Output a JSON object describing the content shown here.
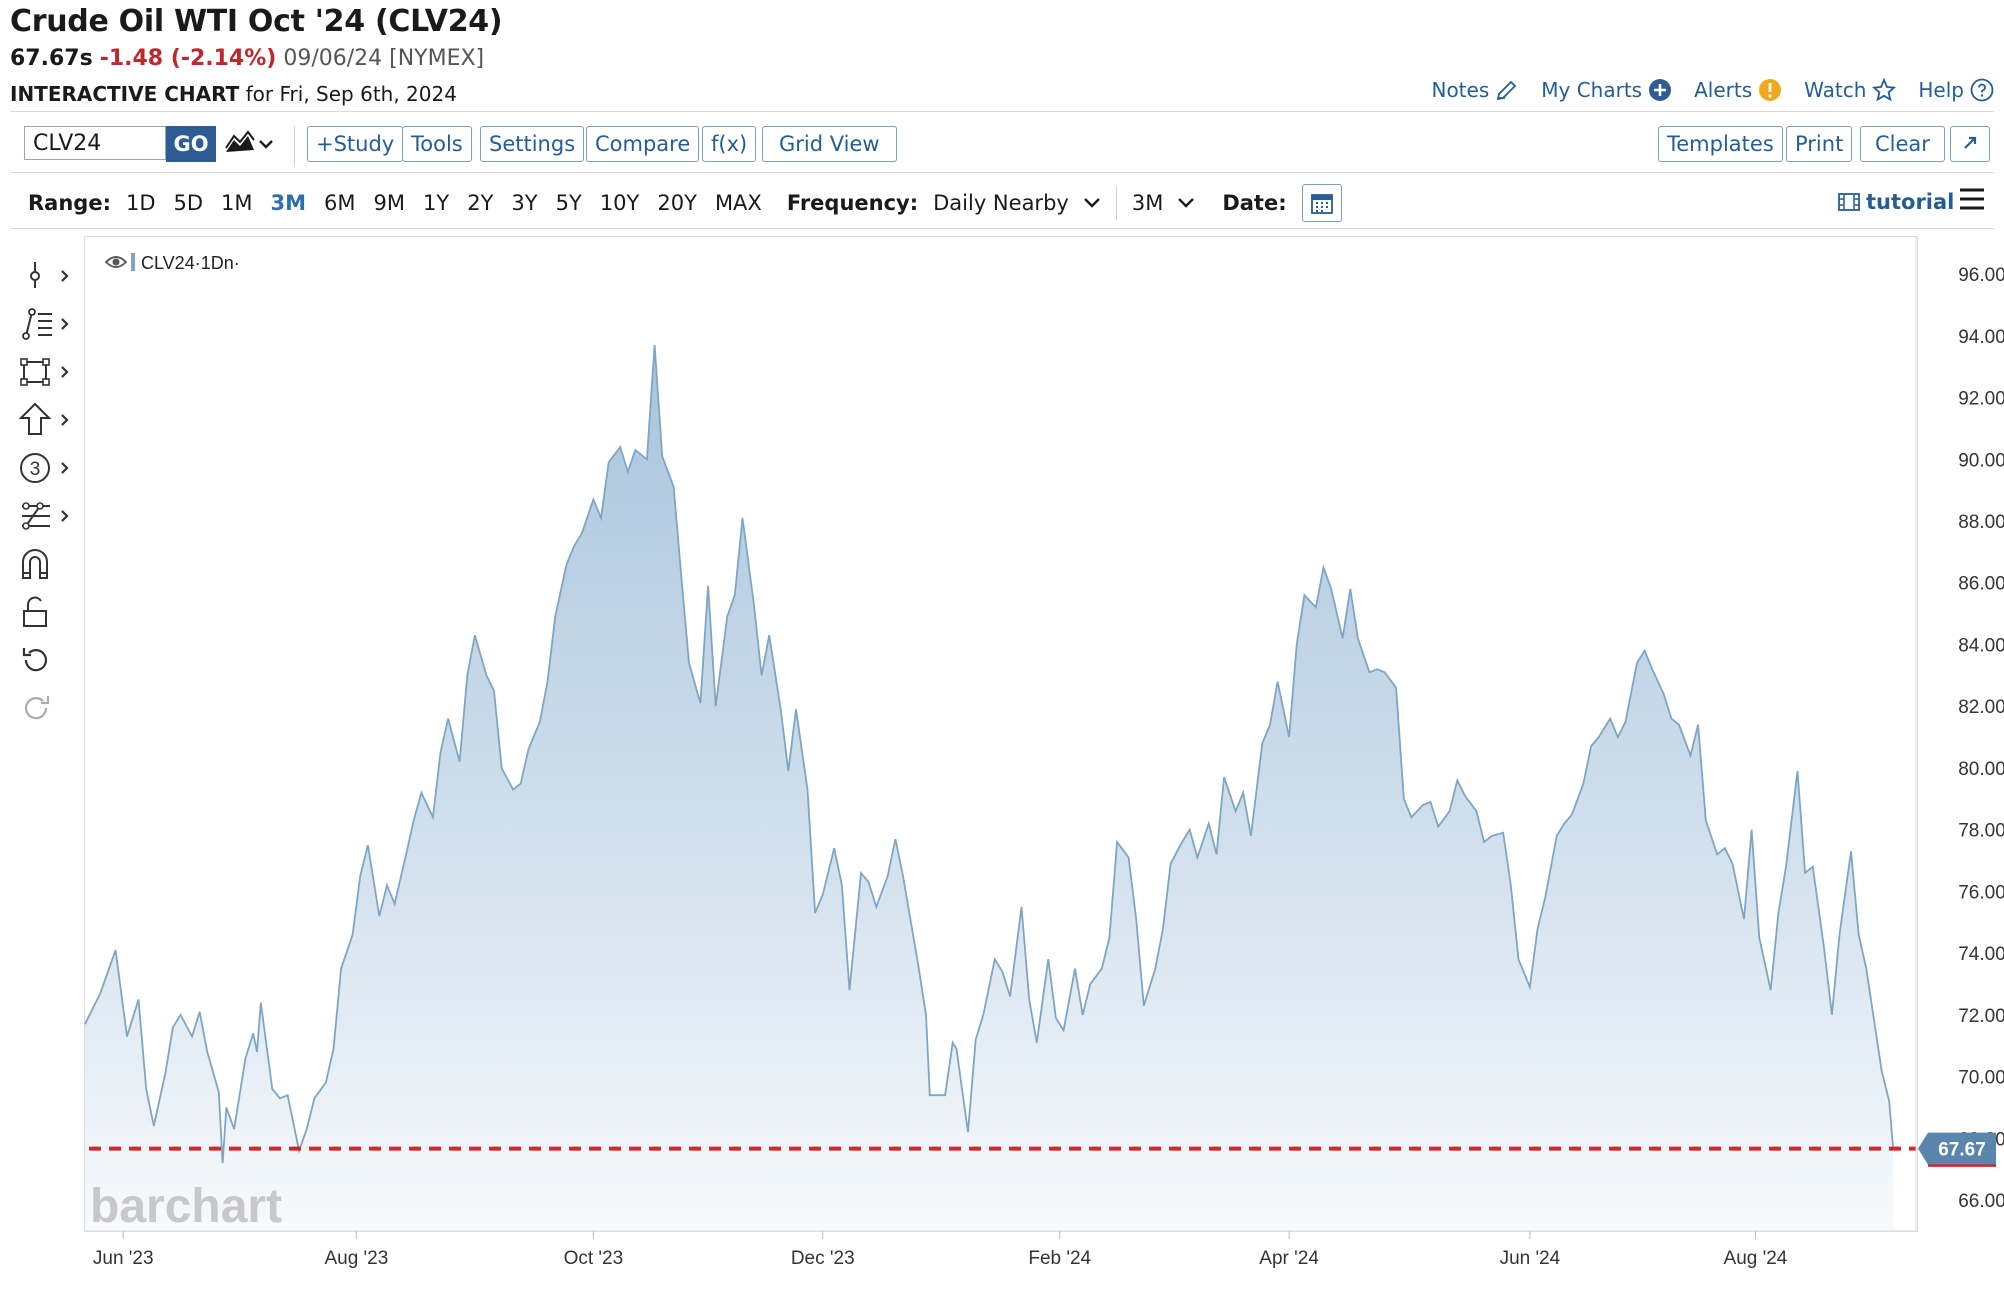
{
  "header": {
    "title": "Crude Oil WTI Oct '24 (CLV24)",
    "last": "67.67s",
    "change": "-1.48 (-2.14%)",
    "quote_date": "09/06/24 [NYMEX]",
    "chart_label": "INTERACTIVE CHART",
    "chart_for": "for Fri, Sep 6th, 2024"
  },
  "toplinks": {
    "notes": "Notes",
    "mycharts": "My Charts",
    "alerts": "Alerts",
    "watch": "Watch",
    "help": "Help"
  },
  "toolbar": {
    "symbol": "CLV24",
    "go": "GO",
    "study": "+Study",
    "tools": "Tools",
    "settings": "Settings",
    "compare": "Compare",
    "fx": "f(x)",
    "gridview": "Grid View",
    "templates": "Templates",
    "print": "Print",
    "clear": "Clear"
  },
  "rangebar": {
    "range_label": "Range:",
    "ranges": [
      "1D",
      "5D",
      "1M",
      "3M",
      "6M",
      "9M",
      "1Y",
      "2Y",
      "3Y",
      "5Y",
      "10Y",
      "20Y",
      "MAX"
    ],
    "active_range": "3M",
    "frequency_label": "Frequency:",
    "frequency": "Daily Nearby",
    "period": "3M",
    "date_label": "Date:",
    "tutorial": "tutorial"
  },
  "colors": {
    "accent": "#245e94",
    "down": "#c0262b",
    "series": "#7ea6c4",
    "fill_top": "#a9c4dc",
    "last_line": "#d6262b"
  },
  "chart_data": {
    "type": "area",
    "legend": "CLV24·1Dn·",
    "watermark": "barchart",
    "last_value_label": "67.67",
    "last_value": 67.67,
    "y_ticks": [
      "96.00",
      "94.00",
      "92.00",
      "90.00",
      "88.00",
      "86.00",
      "84.00",
      "82.00",
      "80.00",
      "78.00",
      "76.00",
      "74.00",
      "72.00",
      "70.00",
      "68.00",
      "66.00"
    ],
    "x_ticks": [
      {
        "label": "Jun '23",
        "x": "2023-06-01"
      },
      {
        "label": "Aug '23",
        "x": "2023-08-01"
      },
      {
        "label": "Oct '23",
        "x": "2023-10-02"
      },
      {
        "label": "Dec '23",
        "x": "2023-12-01"
      },
      {
        "label": "Feb '24",
        "x": "2024-02-01"
      },
      {
        "label": "Apr '24",
        "x": "2024-04-01"
      },
      {
        "label": "Jun '24",
        "x": "2024-06-03"
      },
      {
        "label": "Aug '24",
        "x": "2024-08-01"
      }
    ],
    "xlim": [
      "2023-05-22",
      "2024-09-12"
    ],
    "ylim": [
      65.0,
      97.2
    ],
    "series": [
      {
        "name": "CLV24",
        "points": [
          [
            "2023-05-22",
            71.7
          ],
          [
            "2023-05-26",
            72.7
          ],
          [
            "2023-05-30",
            74.1
          ],
          [
            "2023-06-02",
            71.3
          ],
          [
            "2023-06-05",
            72.5
          ],
          [
            "2023-06-07",
            69.6
          ],
          [
            "2023-06-09",
            68.4
          ],
          [
            "2023-06-12",
            70.1
          ],
          [
            "2023-06-14",
            71.6
          ],
          [
            "2023-06-16",
            72.0
          ],
          [
            "2023-06-19",
            71.3
          ],
          [
            "2023-06-21",
            72.1
          ],
          [
            "2023-06-23",
            70.8
          ],
          [
            "2023-06-26",
            69.5
          ],
          [
            "2023-06-27",
            67.2
          ],
          [
            "2023-06-28",
            69.0
          ],
          [
            "2023-06-30",
            68.3
          ],
          [
            "2023-07-03",
            70.6
          ],
          [
            "2023-07-05",
            71.4
          ],
          [
            "2023-07-06",
            70.8
          ],
          [
            "2023-07-07",
            72.4
          ],
          [
            "2023-07-10",
            69.6
          ],
          [
            "2023-07-12",
            69.3
          ],
          [
            "2023-07-14",
            69.4
          ],
          [
            "2023-07-17",
            67.6
          ],
          [
            "2023-07-19",
            68.3
          ],
          [
            "2023-07-21",
            69.3
          ],
          [
            "2023-07-24",
            69.8
          ],
          [
            "2023-07-26",
            70.9
          ],
          [
            "2023-07-28",
            73.5
          ],
          [
            "2023-07-31",
            74.6
          ],
          [
            "2023-08-02",
            76.5
          ],
          [
            "2023-08-04",
            77.5
          ],
          [
            "2023-08-07",
            75.2
          ],
          [
            "2023-08-09",
            76.2
          ],
          [
            "2023-08-11",
            75.6
          ],
          [
            "2023-08-14",
            77.2
          ],
          [
            "2023-08-16",
            78.3
          ],
          [
            "2023-08-18",
            79.2
          ],
          [
            "2023-08-21",
            78.4
          ],
          [
            "2023-08-23",
            80.5
          ],
          [
            "2023-08-25",
            81.6
          ],
          [
            "2023-08-28",
            80.2
          ],
          [
            "2023-08-30",
            83.0
          ],
          [
            "2023-09-01",
            84.3
          ],
          [
            "2023-09-04",
            83.0
          ],
          [
            "2023-09-06",
            82.5
          ],
          [
            "2023-09-08",
            80.0
          ],
          [
            "2023-09-11",
            79.3
          ],
          [
            "2023-09-13",
            79.5
          ],
          [
            "2023-09-15",
            80.6
          ],
          [
            "2023-09-18",
            81.5
          ],
          [
            "2023-09-20",
            82.8
          ],
          [
            "2023-09-22",
            84.9
          ],
          [
            "2023-09-25",
            86.6
          ],
          [
            "2023-09-27",
            87.2
          ],
          [
            "2023-09-29",
            87.6
          ],
          [
            "2023-10-02",
            88.7
          ],
          [
            "2023-10-04",
            88.1
          ],
          [
            "2023-10-06",
            89.9
          ],
          [
            "2023-10-09",
            90.4
          ],
          [
            "2023-10-11",
            89.6
          ],
          [
            "2023-10-13",
            90.3
          ],
          [
            "2023-10-16",
            90.0
          ],
          [
            "2023-10-18",
            93.7
          ],
          [
            "2023-10-20",
            90.1
          ],
          [
            "2023-10-23",
            89.1
          ],
          [
            "2023-10-25",
            86.2
          ],
          [
            "2023-10-27",
            83.4
          ],
          [
            "2023-10-30",
            82.1
          ],
          [
            "2023-11-01",
            85.9
          ],
          [
            "2023-11-03",
            82.0
          ],
          [
            "2023-11-06",
            84.9
          ],
          [
            "2023-11-08",
            85.6
          ],
          [
            "2023-11-10",
            88.1
          ],
          [
            "2023-11-13",
            85.3
          ],
          [
            "2023-11-15",
            83.0
          ],
          [
            "2023-11-17",
            84.3
          ],
          [
            "2023-11-20",
            81.9
          ],
          [
            "2023-11-22",
            79.9
          ],
          [
            "2023-11-24",
            81.9
          ],
          [
            "2023-11-27",
            79.3
          ],
          [
            "2023-11-29",
            75.3
          ],
          [
            "2023-12-01",
            75.9
          ],
          [
            "2023-12-04",
            77.4
          ],
          [
            "2023-12-06",
            76.2
          ],
          [
            "2023-12-08",
            72.8
          ],
          [
            "2023-12-11",
            76.6
          ],
          [
            "2023-12-13",
            76.3
          ],
          [
            "2023-12-15",
            75.5
          ],
          [
            "2023-12-18",
            76.5
          ],
          [
            "2023-12-20",
            77.7
          ],
          [
            "2023-12-22",
            76.5
          ],
          [
            "2023-12-26",
            73.6
          ],
          [
            "2023-12-28",
            72.0
          ],
          [
            "2023-12-29",
            69.4
          ],
          [
            "2024-01-02",
            69.4
          ],
          [
            "2024-01-04",
            71.1
          ],
          [
            "2024-01-05",
            70.9
          ],
          [
            "2024-01-08",
            68.2
          ],
          [
            "2024-01-10",
            71.2
          ],
          [
            "2024-01-12",
            72.0
          ],
          [
            "2024-01-15",
            73.8
          ],
          [
            "2024-01-17",
            73.4
          ],
          [
            "2024-01-19",
            72.6
          ],
          [
            "2024-01-22",
            75.5
          ],
          [
            "2024-01-24",
            72.5
          ],
          [
            "2024-01-26",
            71.1
          ],
          [
            "2024-01-29",
            73.8
          ],
          [
            "2024-01-31",
            71.9
          ],
          [
            "2024-02-02",
            71.5
          ],
          [
            "2024-02-05",
            73.5
          ],
          [
            "2024-02-07",
            72.0
          ],
          [
            "2024-02-09",
            73.0
          ],
          [
            "2024-02-12",
            73.5
          ],
          [
            "2024-02-14",
            74.5
          ],
          [
            "2024-02-16",
            77.6
          ],
          [
            "2024-02-19",
            77.1
          ],
          [
            "2024-02-21",
            75.1
          ],
          [
            "2024-02-23",
            72.3
          ],
          [
            "2024-02-26",
            73.5
          ],
          [
            "2024-02-28",
            74.8
          ],
          [
            "2024-03-01",
            76.9
          ],
          [
            "2024-03-04",
            77.6
          ],
          [
            "2024-03-06",
            78.0
          ],
          [
            "2024-03-08",
            77.1
          ],
          [
            "2024-03-11",
            78.2
          ],
          [
            "2024-03-13",
            77.2
          ],
          [
            "2024-03-15",
            79.7
          ],
          [
            "2024-03-18",
            78.6
          ],
          [
            "2024-03-20",
            79.2
          ],
          [
            "2024-03-22",
            77.8
          ],
          [
            "2024-03-25",
            80.8
          ],
          [
            "2024-03-27",
            81.4
          ],
          [
            "2024-03-29",
            82.8
          ],
          [
            "2024-04-01",
            81.0
          ],
          [
            "2024-04-03",
            84.0
          ],
          [
            "2024-04-05",
            85.6
          ],
          [
            "2024-04-08",
            85.2
          ],
          [
            "2024-04-10",
            86.5
          ],
          [
            "2024-04-12",
            85.8
          ],
          [
            "2024-04-15",
            84.2
          ],
          [
            "2024-04-17",
            85.8
          ],
          [
            "2024-04-19",
            84.2
          ],
          [
            "2024-04-22",
            83.1
          ],
          [
            "2024-04-24",
            83.2
          ],
          [
            "2024-04-26",
            83.1
          ],
          [
            "2024-04-29",
            82.6
          ],
          [
            "2024-05-01",
            79.0
          ],
          [
            "2024-05-03",
            78.4
          ],
          [
            "2024-05-06",
            78.8
          ],
          [
            "2024-05-08",
            78.9
          ],
          [
            "2024-05-10",
            78.1
          ],
          [
            "2024-05-13",
            78.6
          ],
          [
            "2024-05-15",
            79.6
          ],
          [
            "2024-05-17",
            79.1
          ],
          [
            "2024-05-20",
            78.6
          ],
          [
            "2024-05-22",
            77.6
          ],
          [
            "2024-05-24",
            77.8
          ],
          [
            "2024-05-27",
            77.9
          ],
          [
            "2024-05-29",
            76.2
          ],
          [
            "2024-05-31",
            73.8
          ],
          [
            "2024-06-03",
            72.9
          ],
          [
            "2024-06-05",
            74.8
          ],
          [
            "2024-06-07",
            75.8
          ],
          [
            "2024-06-10",
            77.8
          ],
          [
            "2024-06-12",
            78.2
          ],
          [
            "2024-06-14",
            78.5
          ],
          [
            "2024-06-17",
            79.5
          ],
          [
            "2024-06-19",
            80.7
          ],
          [
            "2024-06-21",
            81.0
          ],
          [
            "2024-06-24",
            81.6
          ],
          [
            "2024-06-26",
            81.0
          ],
          [
            "2024-06-28",
            81.5
          ],
          [
            "2024-07-01",
            83.4
          ],
          [
            "2024-07-03",
            83.8
          ],
          [
            "2024-07-05",
            83.2
          ],
          [
            "2024-07-08",
            82.4
          ],
          [
            "2024-07-10",
            81.6
          ],
          [
            "2024-07-12",
            81.4
          ],
          [
            "2024-07-15",
            80.4
          ],
          [
            "2024-07-17",
            81.4
          ],
          [
            "2024-07-19",
            78.3
          ],
          [
            "2024-07-22",
            77.2
          ],
          [
            "2024-07-24",
            77.4
          ],
          [
            "2024-07-26",
            76.9
          ],
          [
            "2024-07-29",
            75.1
          ],
          [
            "2024-07-31",
            78.0
          ],
          [
            "2024-08-02",
            74.5
          ],
          [
            "2024-08-05",
            72.8
          ],
          [
            "2024-08-07",
            75.3
          ],
          [
            "2024-08-09",
            76.8
          ],
          [
            "2024-08-12",
            79.9
          ],
          [
            "2024-08-14",
            76.6
          ],
          [
            "2024-08-16",
            76.8
          ],
          [
            "2024-08-19",
            74.1
          ],
          [
            "2024-08-21",
            72.0
          ],
          [
            "2024-08-23",
            74.6
          ],
          [
            "2024-08-26",
            77.3
          ],
          [
            "2024-08-28",
            74.6
          ],
          [
            "2024-08-30",
            73.5
          ],
          [
            "2024-09-03",
            70.2
          ],
          [
            "2024-09-05",
            69.2
          ],
          [
            "2024-09-06",
            67.67
          ]
        ]
      }
    ]
  }
}
